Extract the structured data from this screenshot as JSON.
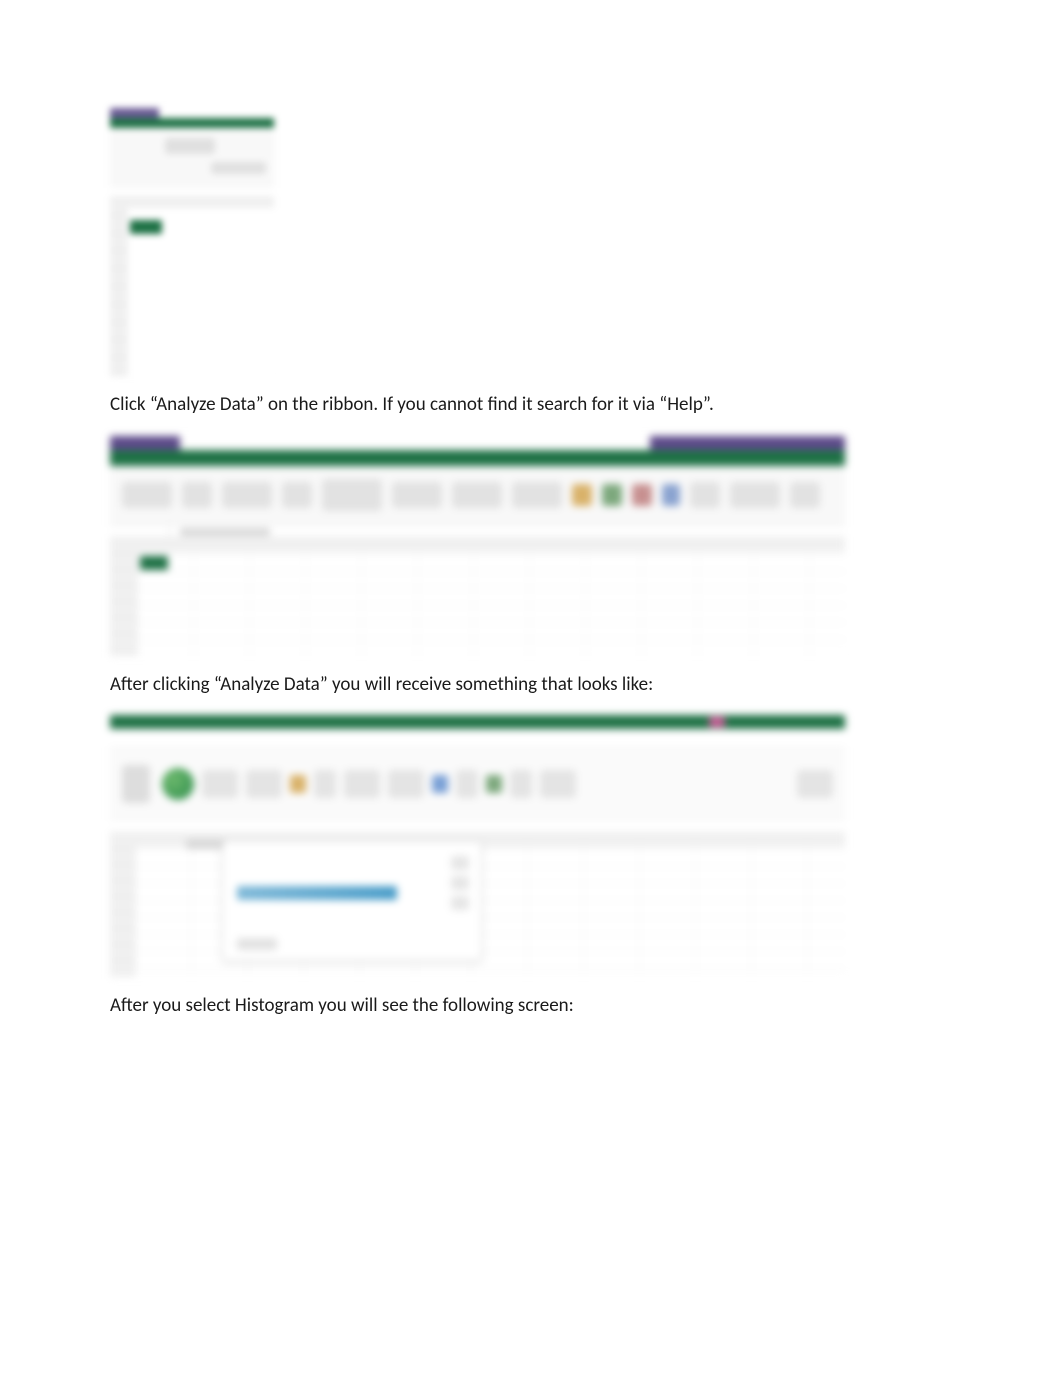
{
  "paragraphs": {
    "p1": "Click “Analyze Data” on the ribbon.  If you cannot find it search for it via “Help”.",
    "p2": "After clicking “Analyze Data” you will receive something that looks like:",
    "p3": "After you select Histogram you will see the following screen:"
  }
}
